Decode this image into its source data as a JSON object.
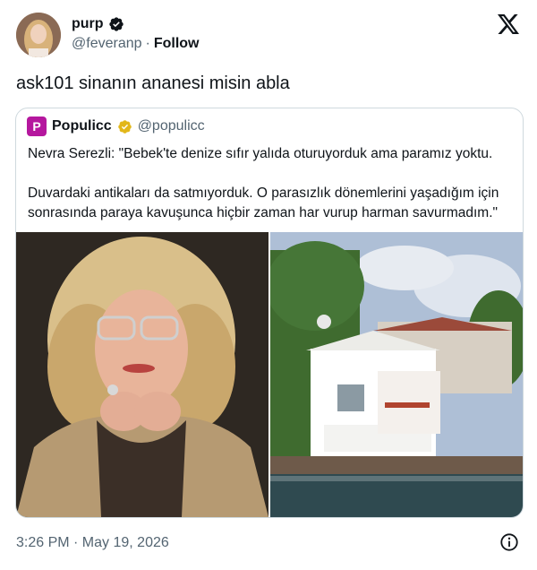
{
  "author": {
    "name": "purp",
    "handle": "@feveranp",
    "separator": "·",
    "follow_label": "Follow"
  },
  "tweet": {
    "text": "ask101 sinanın ananesi misin abla",
    "timestamp": "3:26 PM · May 19, 2026"
  },
  "quoted": {
    "avatar_letter": "P",
    "name": "Populicc",
    "handle": "@populicc",
    "paragraphs": [
      "Nevra Serezli: \"Bebek'te denize sıfır yalıda oturuyorduk ama paramız yoktu.",
      "Duvardaki antikaları da satmıyorduk. O parasızlık dönemlerini yaşadığım için sonrasında paraya kavuşunca hiçbir zaman har vurup harman savurmadım.\""
    ]
  },
  "icons": {
    "verified": "verified-badge-icon",
    "gold_verified": "gold-verified-badge-icon",
    "x_logo": "x-logo-icon",
    "info": "info-icon"
  },
  "colors": {
    "text": "#0f1419",
    "secondary": "#536471",
    "border": "#cfd9de",
    "populicc_brand": "#b5179e",
    "gold_badge": "#e2b719"
  }
}
